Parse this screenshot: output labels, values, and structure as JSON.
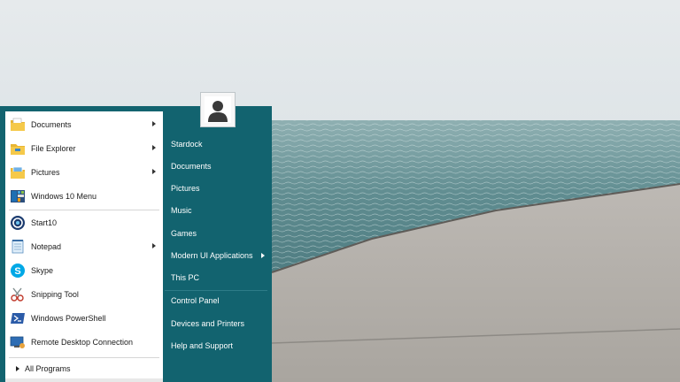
{
  "wallpaper": {
    "description_icon": "sea-and-pier-landscape"
  },
  "start_menu": {
    "accent_color": "#12636f",
    "left_items": [
      {
        "label": "Documents",
        "icon": "documents-folder-icon",
        "submenu": true
      },
      {
        "label": "File Explorer",
        "icon": "file-explorer-icon",
        "submenu": true
      },
      {
        "label": "Pictures",
        "icon": "pictures-folder-icon",
        "submenu": true
      },
      {
        "label": "Windows 10 Menu",
        "icon": "windows10-menu-icon",
        "submenu": false
      },
      {
        "label": "Start10",
        "icon": "start10-icon",
        "submenu": false
      },
      {
        "label": "Notepad",
        "icon": "notepad-icon",
        "submenu": true
      },
      {
        "label": "Skype",
        "icon": "skype-icon",
        "submenu": false
      },
      {
        "label": "Snipping Tool",
        "icon": "snipping-tool-icon",
        "submenu": false
      },
      {
        "label": "Windows PowerShell",
        "icon": "powershell-icon",
        "submenu": false
      },
      {
        "label": "Remote Desktop Connection",
        "icon": "remote-desktop-icon",
        "submenu": false
      }
    ],
    "all_programs": "All Programs",
    "right_items": [
      {
        "label": "Stardock",
        "submenu": false
      },
      {
        "label": "Documents",
        "submenu": false
      },
      {
        "label": "Pictures",
        "submenu": false
      },
      {
        "label": "Music",
        "submenu": false
      },
      {
        "label": "Games",
        "submenu": false
      },
      {
        "label": "Modern UI Applications",
        "submenu": true
      },
      {
        "label": "This PC",
        "submenu": false
      },
      {
        "label": "Control Panel",
        "submenu": false
      },
      {
        "label": "Devices and Printers",
        "submenu": false
      },
      {
        "label": "Help and Support",
        "submenu": false
      }
    ],
    "avatar_icon": "user-avatar-icon"
  }
}
